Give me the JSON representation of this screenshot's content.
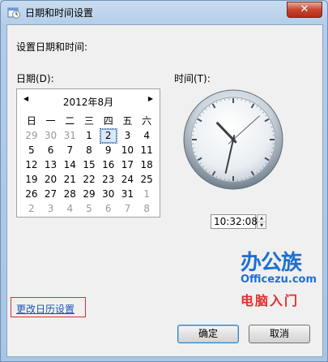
{
  "window": {
    "title": "日期和时间设置",
    "close_label": "✕"
  },
  "heading": "设置日期和时间:",
  "date_label": "日期(D):",
  "time_label": "时间(T):",
  "calendar": {
    "prev": "◀",
    "next": "▶",
    "month_label": "2012年8月",
    "weekdays": [
      "日",
      "一",
      "二",
      "三",
      "四",
      "五",
      "六"
    ],
    "weeks": [
      [
        "29",
        "30",
        "31",
        "1",
        "2",
        "3",
        "4"
      ],
      [
        "5",
        "6",
        "7",
        "8",
        "9",
        "10",
        "11"
      ],
      [
        "12",
        "13",
        "14",
        "15",
        "16",
        "17",
        "18"
      ],
      [
        "19",
        "20",
        "21",
        "22",
        "23",
        "24",
        "25"
      ],
      [
        "26",
        "27",
        "28",
        "29",
        "30",
        "31",
        "1"
      ],
      [
        "2",
        "3",
        "4",
        "5",
        "6",
        "7",
        "8"
      ]
    ],
    "other_month": [
      [
        0,
        0
      ],
      [
        0,
        1
      ],
      [
        0,
        2
      ],
      [
        4,
        6
      ],
      [
        5,
        0
      ],
      [
        5,
        1
      ],
      [
        5,
        2
      ],
      [
        5,
        3
      ],
      [
        5,
        4
      ],
      [
        5,
        5
      ],
      [
        5,
        6
      ]
    ],
    "selected": [
      0,
      4
    ]
  },
  "clock": {
    "hour": 10,
    "minute": 32,
    "second": 8
  },
  "time_value": "10:32:08",
  "watermark": {
    "line1": "办公族",
    "line2": "Officezu.com",
    "line3": "电脑入门"
  },
  "change_calendar_link": "更改日历设置",
  "buttons": {
    "ok": "确定",
    "cancel": "取消"
  }
}
